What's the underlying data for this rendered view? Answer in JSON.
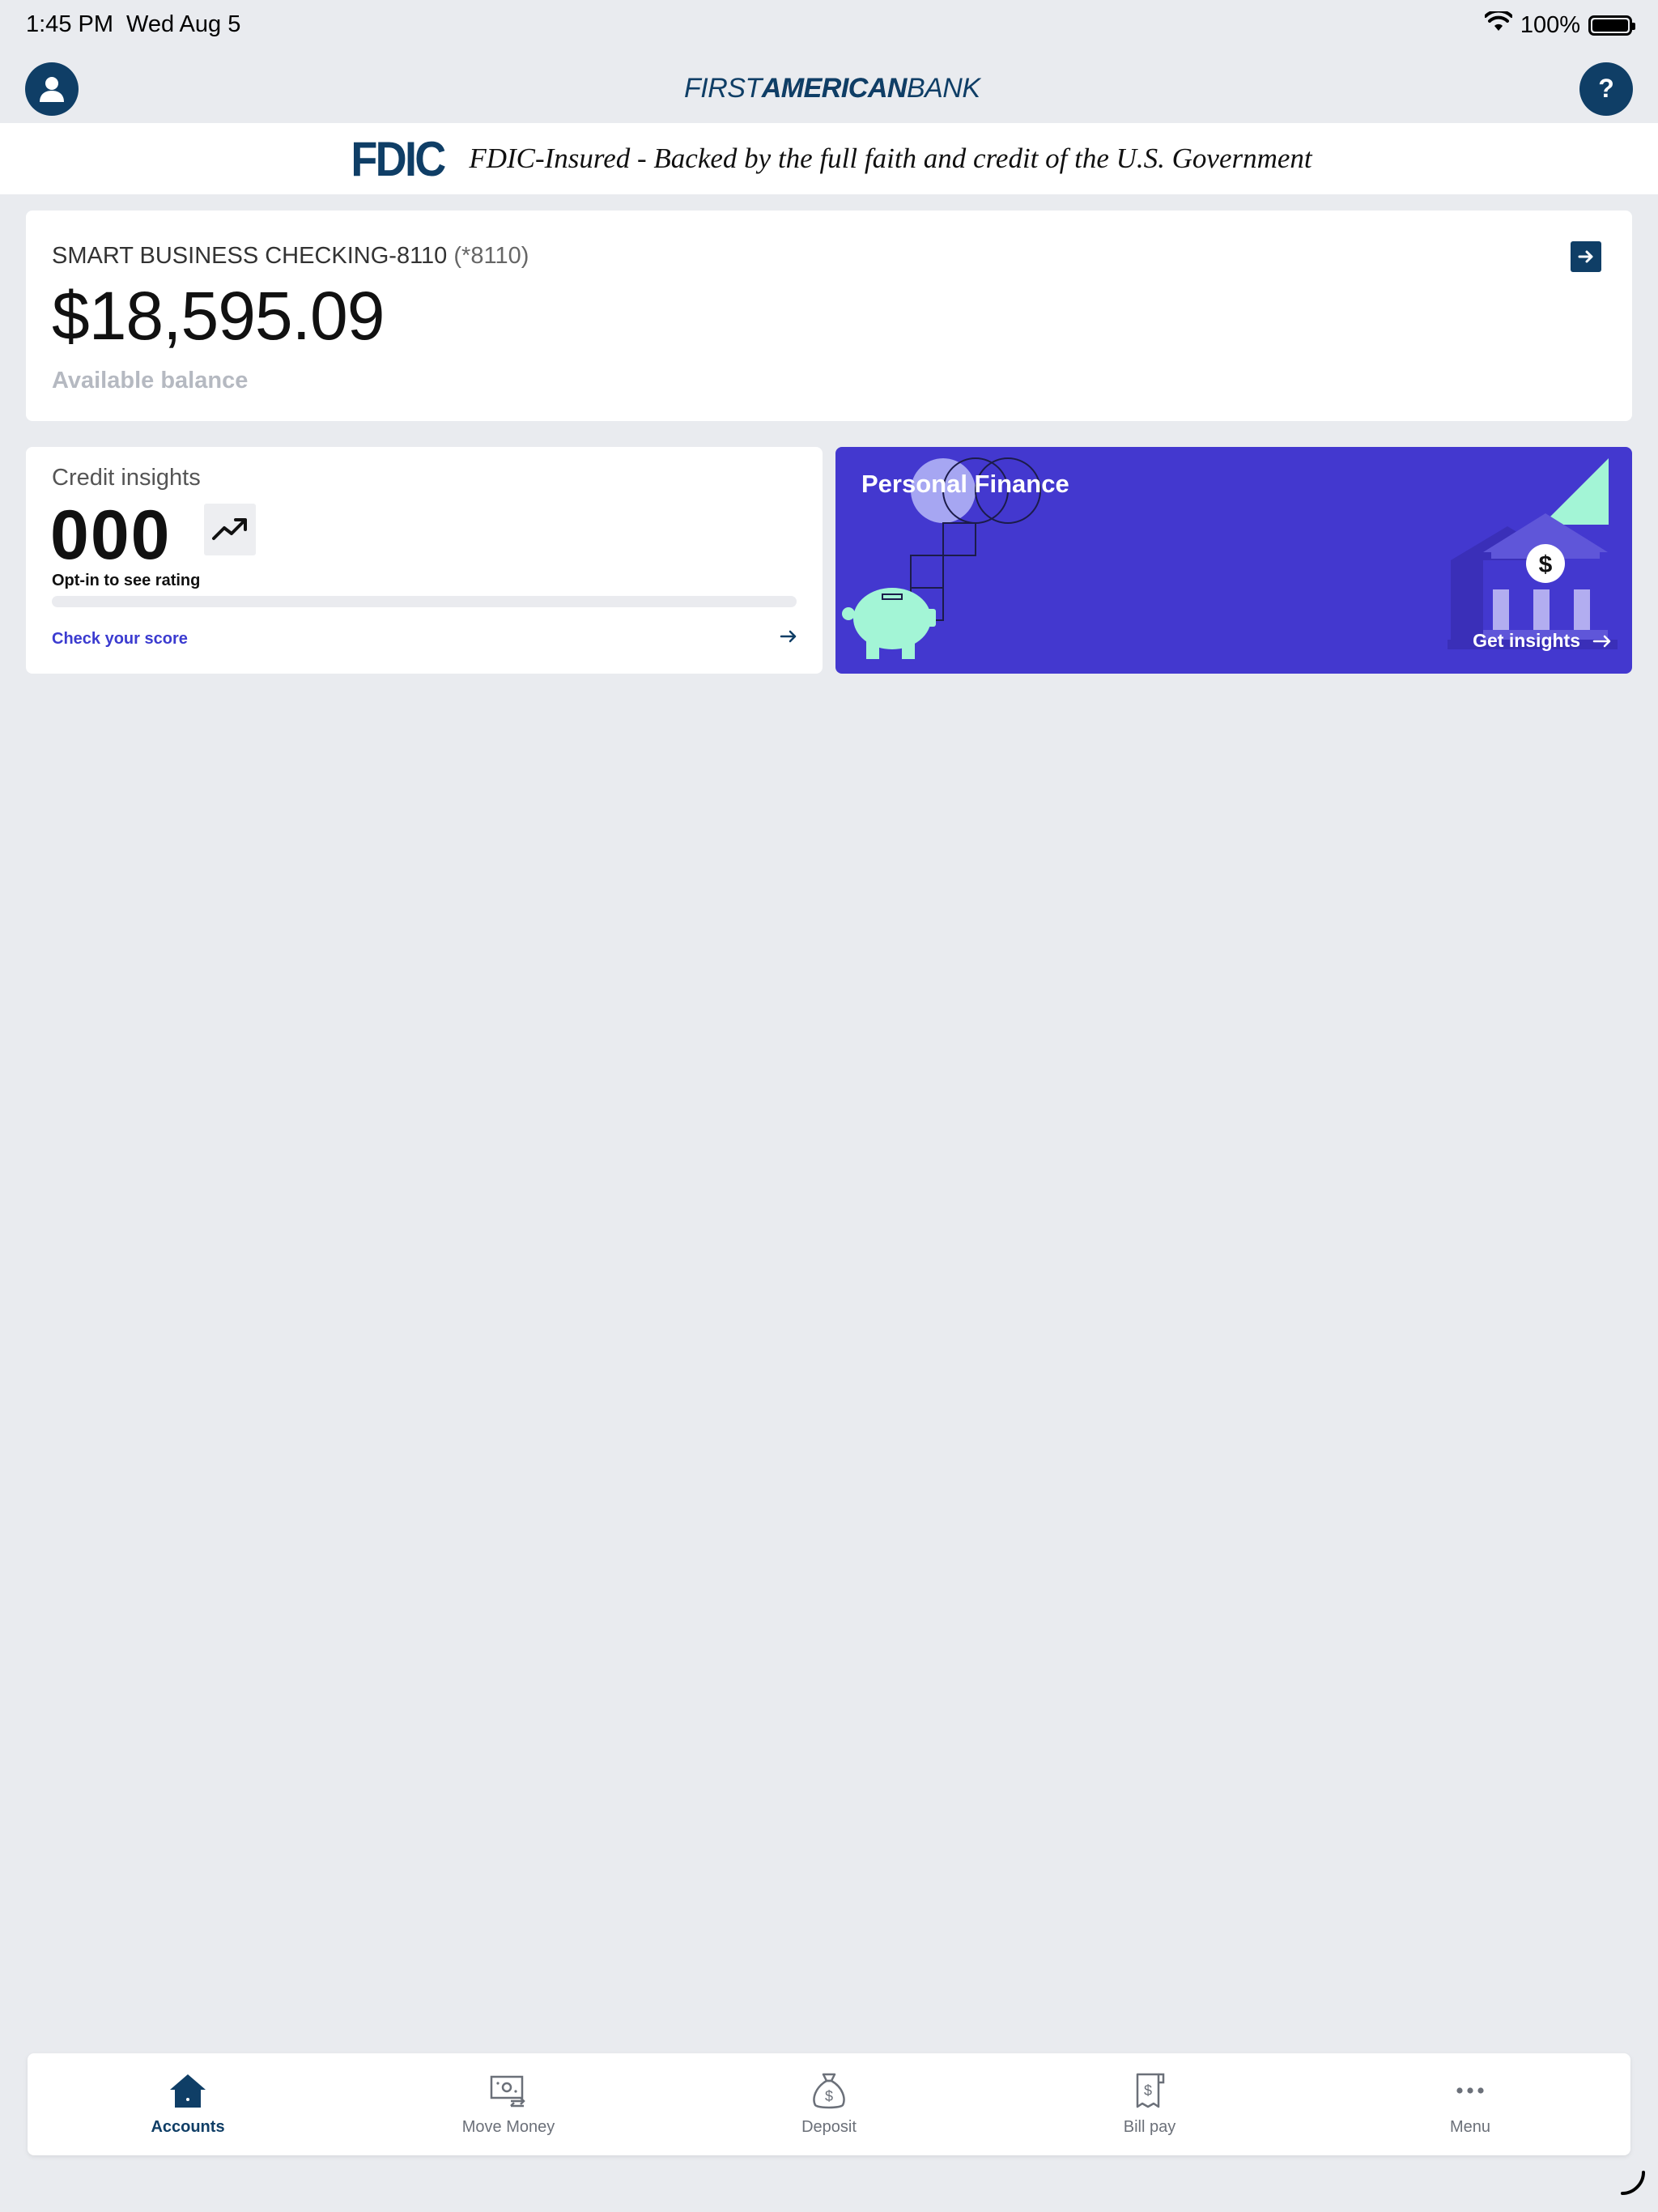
{
  "status_bar": {
    "time": "1:45 PM",
    "date": "Wed Aug 5",
    "battery_text": "100%"
  },
  "header": {
    "logo_part1": "FIRST",
    "logo_part2": "AMERICAN",
    "logo_part3": "BANK",
    "profile_icon": "person-icon",
    "help_icon": "help-question-icon",
    "brand_color": "#0f3e66"
  },
  "fdic": {
    "logo_text": "FDIC",
    "text": "FDIC-Insured - Backed by the full faith and credit of the U.S. Government"
  },
  "account": {
    "name": "SMART BUSINESS CHECKING-8110",
    "number": "(*8110)",
    "balance": "$18,595.09",
    "balance_label": "Available balance"
  },
  "credit": {
    "title": "Credit insights",
    "score": "000",
    "optin_text": "Opt-in to see rating",
    "link_text": "Check your score",
    "bar_fill": 0
  },
  "personal_finance": {
    "title": "Personal Finance",
    "cta": "Get insights",
    "bg_color": "#4338cf",
    "accent_color": "#a3f5d6"
  },
  "tabbar": {
    "tabs": [
      {
        "label": "Accounts",
        "icon": "home-icon",
        "active": true
      },
      {
        "label": "Move Money",
        "icon": "transfer-money-icon",
        "active": false
      },
      {
        "label": "Deposit",
        "icon": "money-bag-icon",
        "active": false
      },
      {
        "label": "Bill pay",
        "icon": "bill-receipt-icon",
        "active": false
      },
      {
        "label": "Menu",
        "icon": "more-dots-icon",
        "active": false
      }
    ]
  }
}
